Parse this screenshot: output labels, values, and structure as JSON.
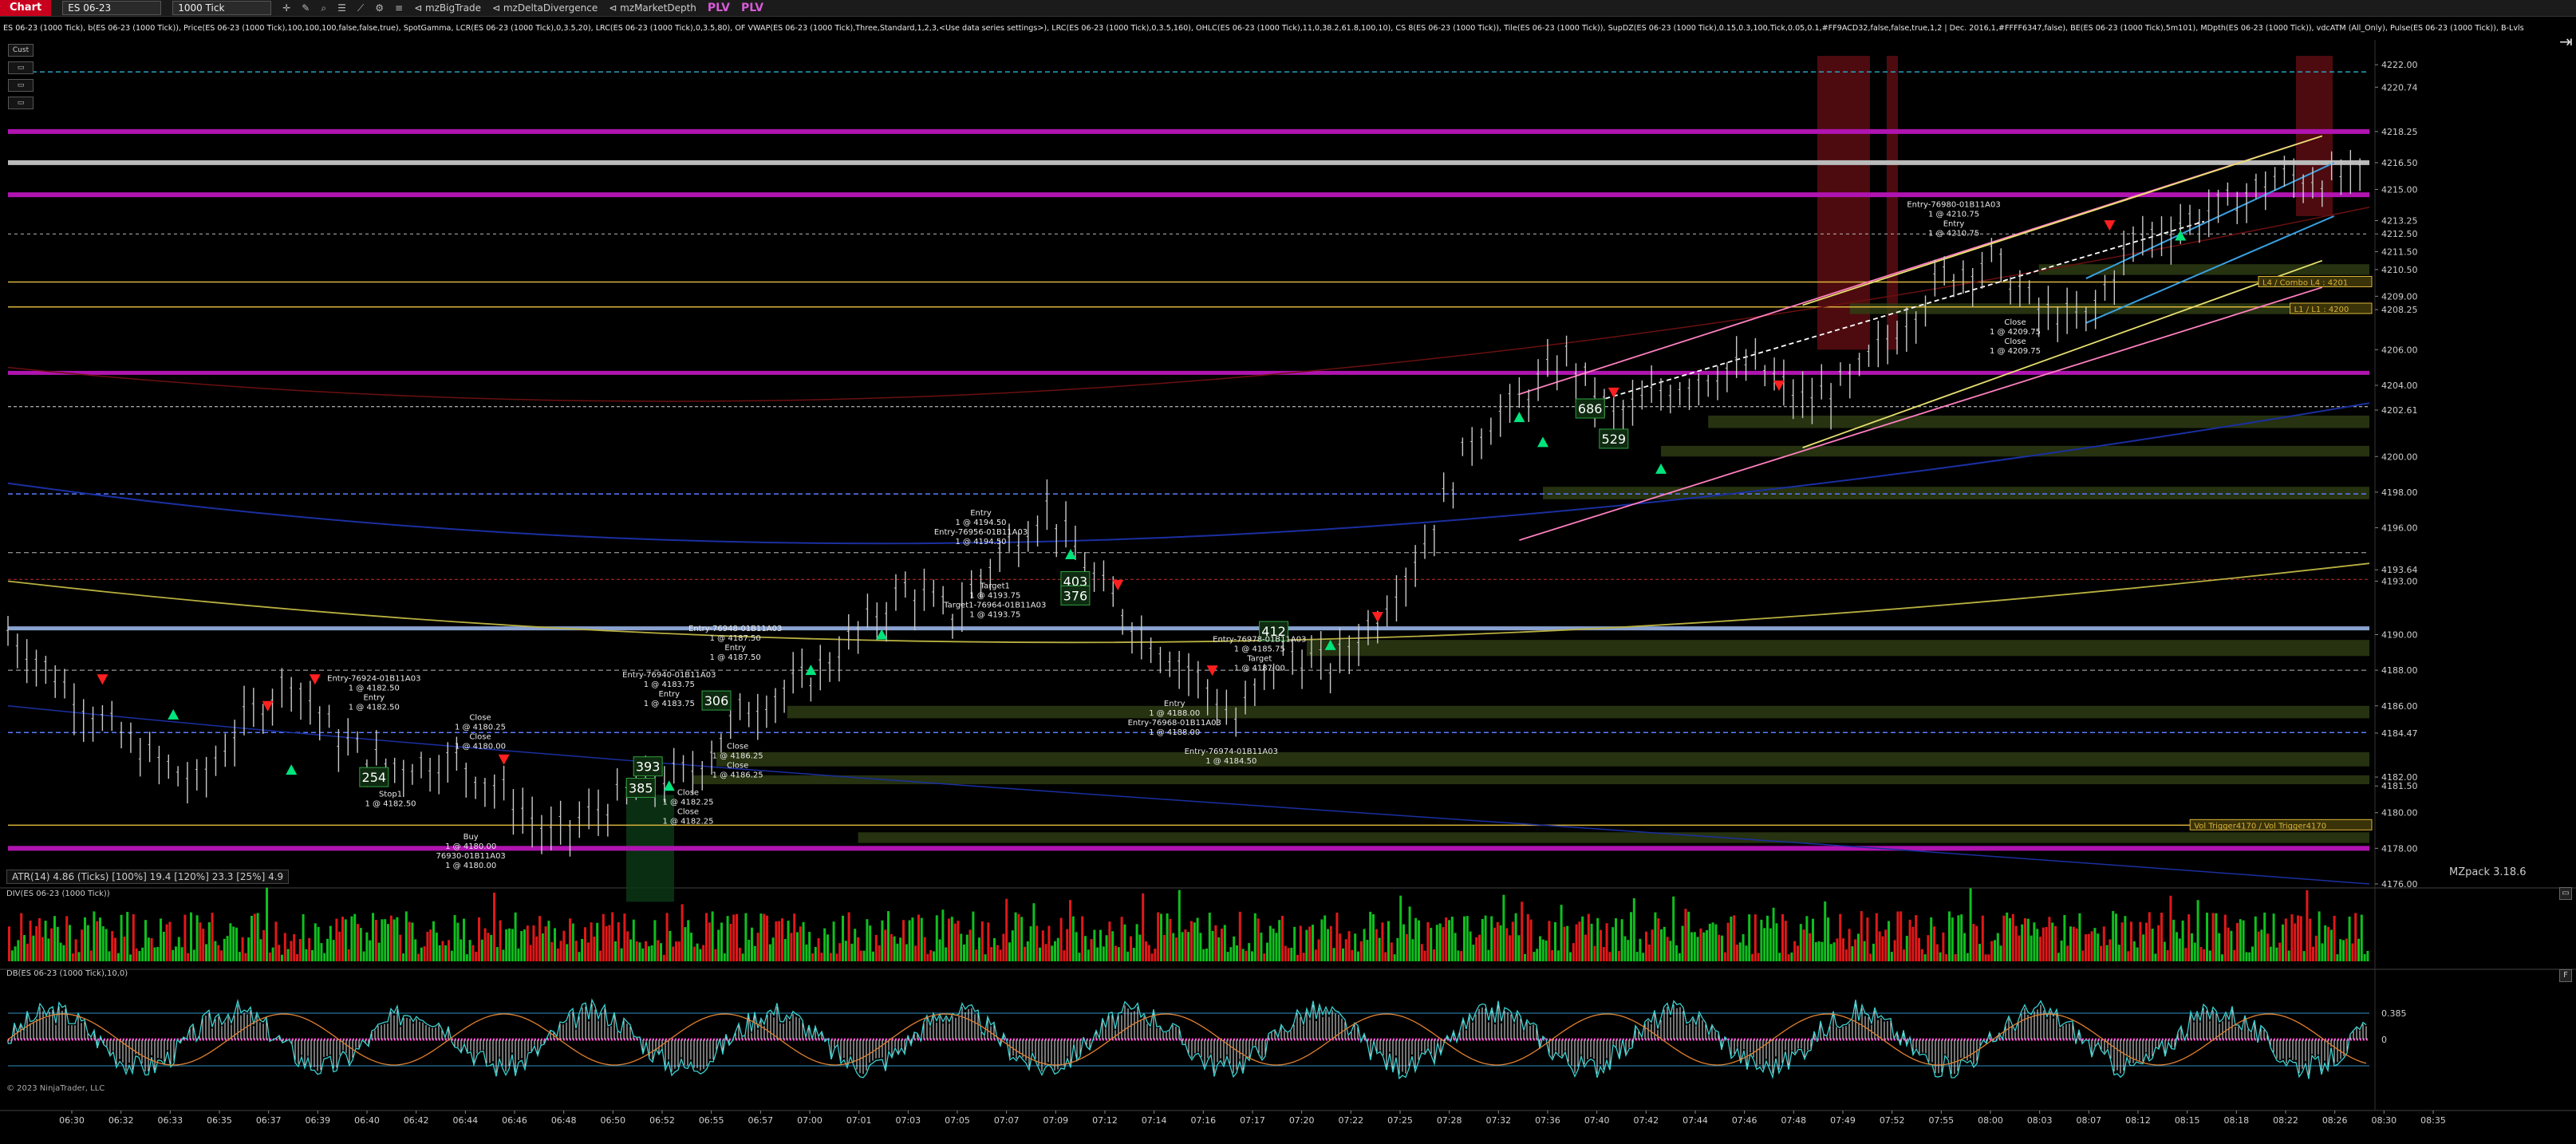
{
  "toolbar": {
    "tab": "Chart",
    "instrument": "ES 06-23",
    "interval": "1000 Tick",
    "links": [
      "mzBigTrade",
      "mzDeltaDivergence",
      "mzMarketDepth"
    ],
    "plv": [
      "PLV",
      "PLV"
    ]
  },
  "indicator_line": "ES 06-23 (1000 Tick), b(ES 06-23 (1000 Tick)), Price(ES 06-23 (1000 Tick),100,100,100,false,false,true), SpotGamma, LCR(ES 06-23 (1000 Tick),0,3.5,20), LRC(ES 06-23 (1000 Tick),0,3.5,80), OF VWAP(ES 06-23 (1000 Tick),Three,Standard,1,2,3,<Use data series settings>), LRC(ES 06-23 (1000 Tick),0,3.5,160), OHLC(ES 06-23 (1000 Tick),11,0,38.2,61.8,100,10), CS 8(ES 06-23 (1000 Tick)), Tile(ES 06-23 (1000 Tick)), SupDZ(ES 06-23 (1000 Tick),0.15,0.3,100,Tick,0.05,0.1,#FF9ACD32,false,false,true,1,2 | Dec. 2016,1,#FFFF6347,false), BE(ES 06-23 (1000 Tick),5m101), MDpth(ES 06-23 (1000 Tick)), vdcATM (All_Only), Pulse(ES 06-23 (1000 Tick)), B-Lvls",
  "left_tools": [
    "Cust",
    "▭",
    "▭",
    "▭"
  ],
  "price_axis": {
    "labels": [
      "4222.00",
      "4220.74",
      "4218.25",
      "4216.50",
      "4215.00",
      "4213.25",
      "4212.50",
      "4211.50",
      "4210.50",
      "4209.00",
      "4208.25",
      "4206.00",
      "4204.00",
      "4202.61",
      "4200.00",
      "4198.00",
      "4196.00",
      "4193.64",
      "4193.00",
      "4190.00",
      "4188.00",
      "4186.00",
      "4184.47",
      "4182.00",
      "4181.50",
      "4180.00",
      "4178.00",
      "4176.00"
    ],
    "values": [
      4222.0,
      4220.74,
      4218.25,
      4216.5,
      4215.0,
      4213.25,
      4212.5,
      4211.5,
      4210.5,
      4209.0,
      4208.25,
      4206.0,
      4204.0,
      4202.61,
      4200.0,
      4198.0,
      4196.0,
      4193.64,
      4193.0,
      4190.0,
      4188.0,
      4186.0,
      4184.47,
      4182.0,
      4181.5,
      4180.0,
      4178.0,
      4176.0
    ]
  },
  "level_labels": [
    {
      "text": "L4 / Combo L4 : 4201",
      "color": "#d9b43a",
      "value": 4209.8
    },
    {
      "text": "L1 / L1 : 4200",
      "color": "#d9b43a",
      "value": 4208.3
    },
    {
      "text": "Vol Trigger4170 / Vol Trigger4170",
      "color": "#d9b43a",
      "value": 4179.3
    }
  ],
  "time_axis": [
    "06:30",
    "06:32",
    "06:33",
    "06:35",
    "06:37",
    "06:39",
    "06:40",
    "06:42",
    "06:44",
    "06:46",
    "06:48",
    "06:50",
    "06:52",
    "06:55",
    "06:57",
    "07:00",
    "07:01",
    "07:03",
    "07:05",
    "07:07",
    "07:09",
    "07:12",
    "07:14",
    "07:16",
    "07:17",
    "07:20",
    "07:22",
    "07:25",
    "07:28",
    "07:32",
    "07:36",
    "07:40",
    "07:42",
    "07:44",
    "07:46",
    "07:48",
    "07:49",
    "07:52",
    "07:55",
    "08:00",
    "08:03",
    "08:07",
    "08:12",
    "08:15",
    "08:18",
    "08:22",
    "08:26",
    "08:30",
    "08:35"
  ],
  "boxes": [
    {
      "text": "254",
      "price": 4182.0,
      "t": 0.155
    },
    {
      "text": "306",
      "price": 4186.3,
      "t": 0.3
    },
    {
      "text": "393",
      "price": 4182.6,
      "t": 0.271
    },
    {
      "text": "385",
      "price": 4181.4,
      "t": 0.268
    },
    {
      "text": "403",
      "price": 4193.0,
      "t": 0.452
    },
    {
      "text": "376",
      "price": 4192.2,
      "t": 0.452
    },
    {
      "text": "412",
      "price": 4190.2,
      "t": 0.536
    },
    {
      "text": "686",
      "price": 4202.7,
      "t": 0.67
    },
    {
      "text": "529",
      "price": 4201.0,
      "t": 0.68
    }
  ],
  "trade_labels": [
    {
      "lines": [
        "Entry-76924-01B11A03",
        "1 @ 4182.50",
        "Entry",
        "1 @ 4182.50"
      ],
      "price": 4187.4,
      "t": 0.155
    },
    {
      "lines": [
        "Stop1",
        "1 @ 4182.50"
      ],
      "price": 4180.9,
      "t": 0.162
    },
    {
      "lines": [
        "Close",
        "1 @ 4180.25",
        "Close",
        "1 @ 4180.00"
      ],
      "price": 4185.2,
      "t": 0.2
    },
    {
      "lines": [
        "Buy",
        "1 @ 4180.00",
        "76930-01B11A03",
        "1 @ 4180.00"
      ],
      "price": 4178.5,
      "t": 0.196
    },
    {
      "lines": [
        "Entry-76940-01B11A03",
        "1 @ 4183.75",
        "Entry",
        "1 @ 4183.75"
      ],
      "price": 4187.6,
      "t": 0.28
    },
    {
      "lines": [
        "Close",
        "1 @ 4186.25",
        "Close",
        "1 @ 4186.25"
      ],
      "price": 4183.6,
      "t": 0.309
    },
    {
      "lines": [
        "Close",
        "1 @ 4182.25",
        "Close",
        "1 @ 4182.25"
      ],
      "price": 4181.0,
      "t": 0.288
    },
    {
      "lines": [
        "Entry-76948-01B11A03",
        "1 @ 4187.50",
        "Entry",
        "1 @ 4187.50"
      ],
      "price": 4190.2,
      "t": 0.308
    },
    {
      "lines": [
        "Entry",
        "1 @ 4194.50",
        "Entry-76956-01B11A03",
        "1 @ 4194.50"
      ],
      "price": 4196.7,
      "t": 0.412
    },
    {
      "lines": [
        "Target1",
        "1 @ 4193.75",
        "Target1-76964-01B11A03",
        "1 @ 4193.75"
      ],
      "price": 4192.6,
      "t": 0.418
    },
    {
      "lines": [
        "Entry",
        "1 @ 4188.00",
        "Entry-76968-01B11A03",
        "1 @ 4188.00"
      ],
      "price": 4186.0,
      "t": 0.494
    },
    {
      "lines": [
        "Entry-76974-01B11A03",
        "1 @ 4184.50"
      ],
      "price": 4183.3,
      "t": 0.518
    },
    {
      "lines": [
        "Entry-76978-01B11A03",
        "1 @ 4185.75",
        "Target",
        "1 @ 4187.00"
      ],
      "price": 4189.6,
      "t": 0.53
    },
    {
      "lines": [
        "Entry-76980-01B11A03",
        "1 @ 4210.75",
        "Entry",
        "1 @ 4210.75"
      ],
      "price": 4214.0,
      "t": 0.824
    },
    {
      "lines": [
        "Close",
        "1 @ 4209.75",
        "Close",
        "1 @ 4209.75"
      ],
      "price": 4207.4,
      "t": 0.85
    }
  ],
  "atr": "ATR(14)  4.86 (Ticks) [100%] 19.4  [120%] 23.3  [25%] 4.9",
  "mzpack": "MZpack 3.18.6",
  "volume_pane_title": "DIV(ES 06-23 (1000 Tick))",
  "osc_pane_title": "DB(ES 06-23 (1000 Tick),10,0)",
  "osc_axis": [
    "0.385",
    "0"
  ],
  "copyright": "© 2023 NinjaTrader, LLC",
  "pane_button": "F",
  "colors": {
    "bg": "#000000",
    "magenta": "#b014b0",
    "pink": "#ff80c0",
    "yellow": "#e8e070",
    "up": "#00e47c",
    "down": "#ff1f1f",
    "zone": "#2f3f14",
    "dashed_blue": "#5a7cff"
  }
}
